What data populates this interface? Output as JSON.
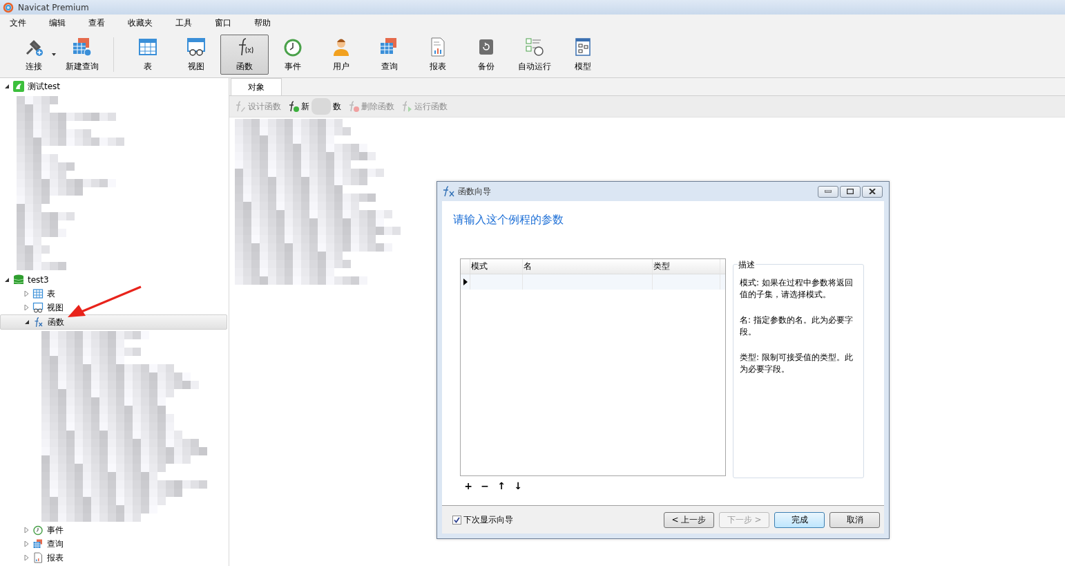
{
  "window": {
    "title": "Navicat Premium"
  },
  "menu": [
    "文件",
    "编辑",
    "查看",
    "收藏夹",
    "工具",
    "窗口",
    "帮助"
  ],
  "toolbar": [
    {
      "label": "连接",
      "kind": "connect",
      "selected": false
    },
    {
      "label": "新建查询",
      "kind": "newquery",
      "selected": false
    },
    {
      "label": "表",
      "kind": "table",
      "selected": false
    },
    {
      "label": "视图",
      "kind": "view",
      "selected": false
    },
    {
      "label": "函数",
      "kind": "function",
      "selected": true
    },
    {
      "label": "事件",
      "kind": "event",
      "selected": false
    },
    {
      "label": "用户",
      "kind": "user",
      "selected": false
    },
    {
      "label": "查询",
      "kind": "query",
      "selected": false
    },
    {
      "label": "报表",
      "kind": "report",
      "selected": false
    },
    {
      "label": "备份",
      "kind": "backup",
      "selected": false
    },
    {
      "label": "自动运行",
      "kind": "schedule",
      "selected": false
    },
    {
      "label": "模型",
      "kind": "model",
      "selected": false
    }
  ],
  "tree": [
    {
      "label": "测试test",
      "kind": "connection",
      "expanded": true
    },
    {
      "label": "test3",
      "kind": "database",
      "expanded": true,
      "children": [
        {
          "label": "表",
          "kind": "table",
          "expanded": false,
          "selected": false
        },
        {
          "label": "视图",
          "kind": "view",
          "expanded": false,
          "selected": false
        },
        {
          "label": "函数",
          "kind": "function",
          "expanded": true,
          "selected": true
        },
        {
          "label": "事件",
          "kind": "event",
          "expanded": false,
          "selected": false
        },
        {
          "label": "查询",
          "kind": "query",
          "expanded": false,
          "selected": false
        },
        {
          "label": "报表",
          "kind": "report",
          "expanded": false,
          "selected": false
        }
      ]
    }
  ],
  "object_tabs": [
    {
      "label": "对象",
      "selected": true
    }
  ],
  "object_toolbar": [
    {
      "label": "设计函数",
      "kind": "design",
      "disabled": true
    },
    {
      "label": "新",
      "label_end": "数",
      "kind": "new",
      "disabled": false
    },
    {
      "label": "删除函数",
      "kind": "delete",
      "disabled": true
    },
    {
      "label": "运行函数",
      "kind": "run",
      "disabled": true
    }
  ],
  "dialog": {
    "title": "函数向导",
    "heading": "请输入这个例程的参数",
    "columns": [
      "模式",
      "名",
      "类型"
    ],
    "rows": [
      {
        "current": true
      }
    ],
    "description_title": "描述",
    "description": [
      "模式: 如果在过程中参数将返回值的子集，请选择模式。",
      "名: 指定参数的名。此为必要字段。",
      "类型: 限制可接受值的类型。此为必要字段。"
    ],
    "grid_buttons": [
      "+",
      "−",
      "↑",
      "↓"
    ],
    "checkbox": {
      "label": "下次显示向导",
      "checked": true
    },
    "buttons": [
      {
        "label": "< 上一步",
        "disabled": false,
        "default": false
      },
      {
        "label": "下一步 >",
        "disabled": true,
        "default": false
      },
      {
        "label": "完成",
        "disabled": false,
        "default": true
      },
      {
        "label": "取消",
        "disabled": false,
        "default": false
      }
    ]
  }
}
